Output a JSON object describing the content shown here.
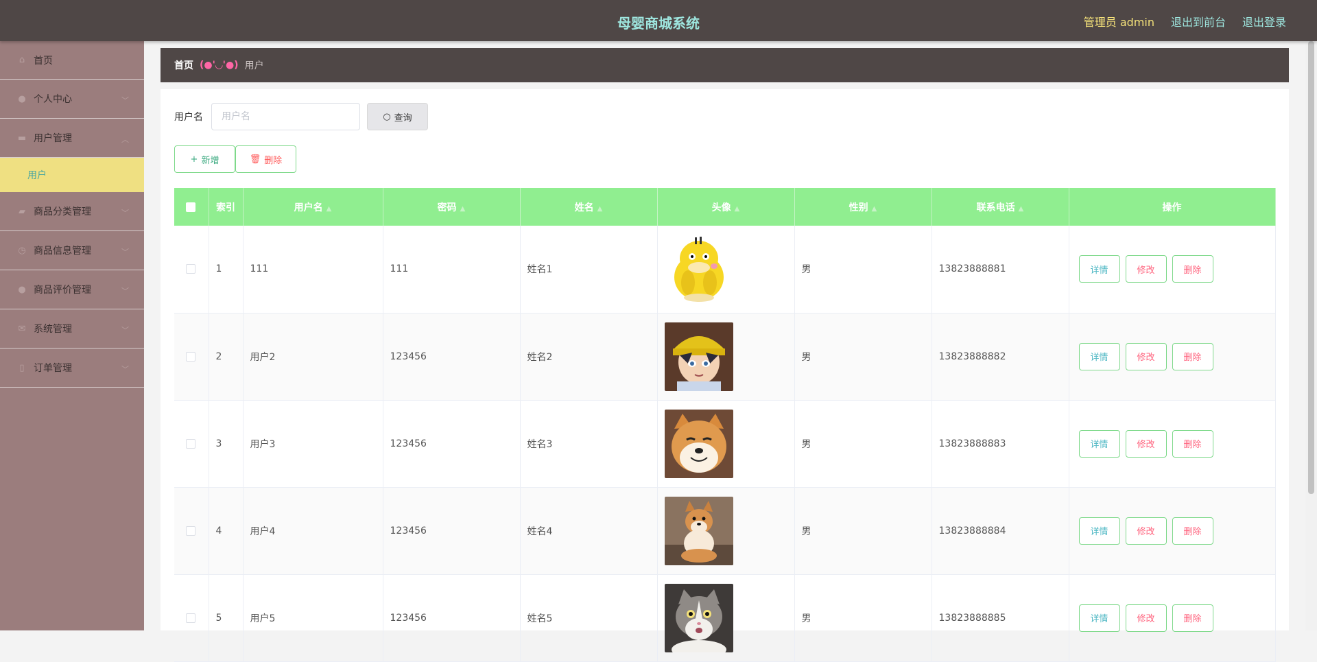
{
  "header": {
    "title": "母婴商城系统",
    "admin_label": "管理员 admin",
    "front_link": "退出到前台",
    "logout_link": "退出登录"
  },
  "sidebar": {
    "items": [
      {
        "label": "首页",
        "icon": "home-icon",
        "expandable": false
      },
      {
        "label": "个人中心",
        "icon": "user-icon",
        "expandable": true
      },
      {
        "label": "用户管理",
        "icon": "users-icon",
        "expandable": true,
        "expanded": true,
        "children": [
          {
            "label": "用户",
            "active": true
          }
        ]
      },
      {
        "label": "商品分类管理",
        "icon": "category-icon",
        "expandable": true
      },
      {
        "label": "商品信息管理",
        "icon": "clock-icon",
        "expandable": true
      },
      {
        "label": "商品评价管理",
        "icon": "user-icon",
        "expandable": true
      },
      {
        "label": "系统管理",
        "icon": "settings-icon",
        "expandable": true
      },
      {
        "label": "订单管理",
        "icon": "order-icon",
        "expandable": true
      }
    ]
  },
  "breadcrumb": {
    "home": "首页",
    "separator": "(●'◡'●)",
    "current": "用户"
  },
  "search": {
    "label": "用户名",
    "placeholder": "用户名",
    "button": "查询"
  },
  "actions": {
    "add": "新增",
    "delete": "删除"
  },
  "table": {
    "columns": [
      "索引",
      "用户名",
      "密码",
      "姓名",
      "头像",
      "性别",
      "联系电话",
      "操作"
    ],
    "rows": [
      {
        "index": "1",
        "username": "111",
        "password": "111",
        "name": "姓名1",
        "avatar": "yellow-duck-cartoon",
        "gender": "男",
        "phone": "13823888881"
      },
      {
        "index": "2",
        "username": "用户2",
        "password": "123456",
        "name": "姓名2",
        "avatar": "anime-boy-yellow-hat",
        "gender": "男",
        "phone": "13823888882"
      },
      {
        "index": "3",
        "username": "用户3",
        "password": "123456",
        "name": "姓名3",
        "avatar": "shiba-dog-smiling",
        "gender": "男",
        "phone": "13823888883"
      },
      {
        "index": "4",
        "username": "用户4",
        "password": "123456",
        "name": "姓名4",
        "avatar": "shiba-puppy-sitting",
        "gender": "男",
        "phone": "13823888884"
      },
      {
        "index": "5",
        "username": "用户5",
        "password": "123456",
        "name": "姓名5",
        "avatar": "gray-white-cat",
        "gender": "男",
        "phone": "13823888885"
      }
    ],
    "row_actions": {
      "detail": "详情",
      "edit": "修改",
      "delete": "删除"
    }
  },
  "colors": {
    "header_bg": "#4f4746",
    "sidebar_bg": "#9b7d7d",
    "active_item_bg": "#efe082",
    "table_header_bg": "#90ee90",
    "title_color": "#9ee6df"
  }
}
